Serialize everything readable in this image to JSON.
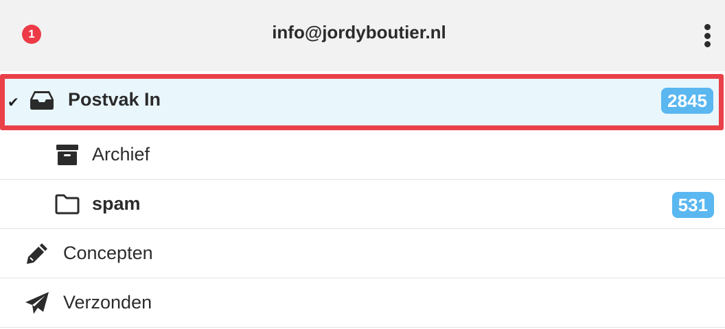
{
  "header": {
    "notification_count": "1",
    "account_email": "info@jordyboutier.nl",
    "menu_icon": "vertical-ellipsis-icon"
  },
  "folders": [
    {
      "label": "Postvak In",
      "icon": "inbox-tray-icon",
      "count": "2845",
      "selected": true,
      "expanded_marker": "✔"
    },
    {
      "label": "Archief",
      "icon": "archive-box-icon",
      "count": ""
    },
    {
      "label": "spam",
      "icon": "folder-outline-icon",
      "count": "531"
    },
    {
      "label": "Concepten",
      "icon": "pencil-icon",
      "count": ""
    },
    {
      "label": "Verzonden",
      "icon": "paper-plane-icon",
      "count": ""
    }
  ],
  "colors": {
    "header_bg": "#f2f2f2",
    "selected_bg": "#e9f7fd",
    "selection_outline": "#ea4149",
    "count_badge": "#5ab7f0",
    "notification_badge": "#ec3b47"
  }
}
